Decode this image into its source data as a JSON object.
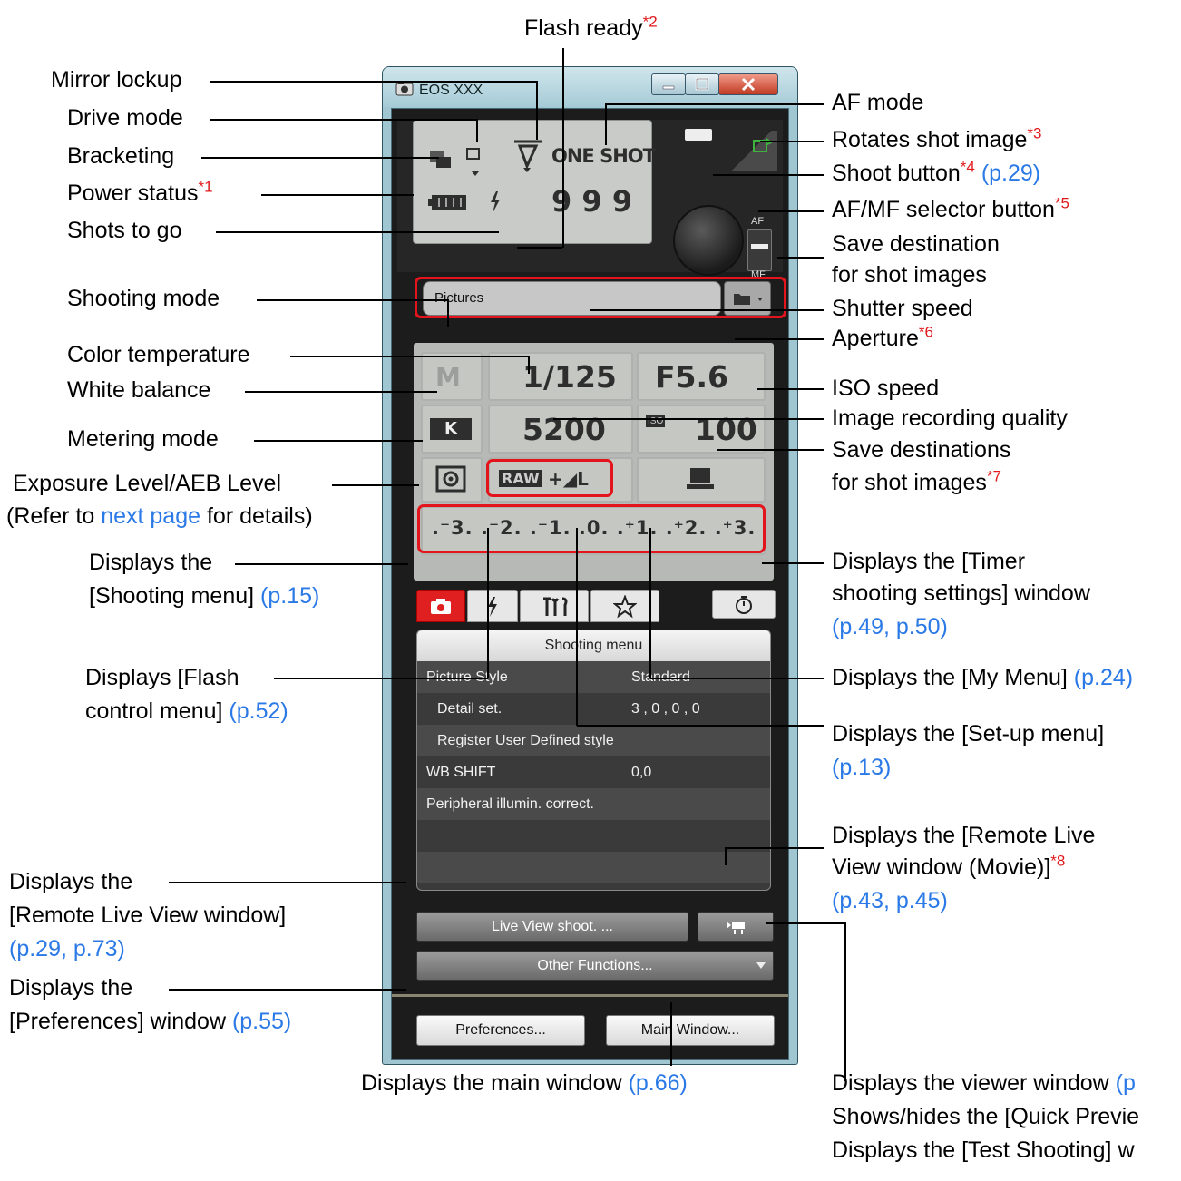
{
  "window": {
    "title": "EOS XXX",
    "status_panel": {
      "mode_chars": "▣",
      "one_shot": "ONE SHOT",
      "shots": "9 9 9",
      "save_field": "Pictures",
      "shooting_mode": "M",
      "shutter": "1/125",
      "aperture": "F5.6",
      "wb_letter": "K",
      "color_temp": "5200",
      "iso_tag": "ISO",
      "iso": "100",
      "raw": "RAW",
      "quality": "+◢L",
      "exposure_scale": ".⁻3. .⁻2. .⁻1. .0. .⁺1. .⁺2. .⁺3.",
      "af": "AF",
      "mf": "MF"
    },
    "menu": {
      "header": "Shooting menu",
      "rows": [
        {
          "key": "Picture Style",
          "value": "Standard"
        },
        {
          "key": "Detail set.",
          "value": "3 , 0 , 0 , 0"
        },
        {
          "key": "Register User Defined style",
          "value": ""
        },
        {
          "key": "WB SHIFT",
          "value": "0,0"
        },
        {
          "key": "Peripheral illumin. correct.",
          "value": ""
        }
      ]
    },
    "buttons": {
      "live_view": "Live View shoot. ...",
      "other_functions": "Other Functions...",
      "preferences": "Preferences...",
      "main_window": "Main Window..."
    }
  },
  "callouts": {
    "flash_ready": "Flash ready",
    "flash_ready_sup": "*2",
    "mirror_lockup": "Mirror lockup",
    "drive_mode": "Drive mode",
    "bracketing": "Bracketing",
    "power_status": "Power status",
    "power_status_sup": "*1",
    "shots_to_go": "Shots to go",
    "shooting_mode": "Shooting mode",
    "color_temperature": "Color temperature",
    "white_balance": "White balance",
    "metering_mode": "Metering mode",
    "exposure_level": "Exposure Level/AEB Level",
    "refer_a": "(Refer to ",
    "refer_link": "next page",
    "refer_b": " for details)",
    "displays_the": "Displays the",
    "shooting_menu": "[Shooting menu] ",
    "shooting_menu_ref": "(p.15)",
    "displays_flash_1": "Displays [Flash",
    "displays_flash_2": "control menu] ",
    "flash_ref": "(p.52)",
    "rlv_1": "Displays the",
    "rlv_2": "[Remote Live View window]",
    "rlv_ref": "(p.29, p.73)",
    "pref_1": "Displays the",
    "pref_2": "[Preferences] window ",
    "pref_ref": "(p.55)",
    "main_window": "Displays the main window ",
    "main_window_ref": "(p.66)",
    "af_mode": "AF mode",
    "rotates": "Rotates shot image",
    "rotates_sup": "*3",
    "shoot_button": "Shoot button",
    "shoot_button_sup": "*4",
    "shoot_button_ref": "(p.29)",
    "afmf_selector": "AF/MF selector button",
    "afmf_sup": "*5",
    "save_dest_1": "Save destination",
    "save_dest_2": "for shot images",
    "shutter_speed": "Shutter speed",
    "aperture": "Aperture",
    "aperture_sup": "*6",
    "iso_speed": "ISO speed",
    "img_quality": "Image recording quality",
    "save_dests_1": "Save destinations",
    "save_dests_2": "for shot images",
    "save_dests_sup": "*7",
    "timer_1": "Displays the [Timer",
    "timer_2": "shooting settings] window",
    "timer_ref": "(p.49, p.50)",
    "my_menu": "Displays the [My Menu] ",
    "my_menu_ref": "(p.24)",
    "setup_1": "Displays the [Set-up menu]",
    "setup_ref": "(p.13)",
    "rlv_movie_1": "Displays the [Remote Live",
    "rlv_movie_2": "View window (Movie)]",
    "rlv_movie_sup": "*8",
    "rlv_movie_ref": "(p.43, p.45)",
    "viewer_1": "Displays the viewer window ",
    "viewer_ref": "(p",
    "viewer_2": "Shows/hides the [Quick Previe",
    "viewer_3": "Displays the [Test Shooting] w"
  }
}
